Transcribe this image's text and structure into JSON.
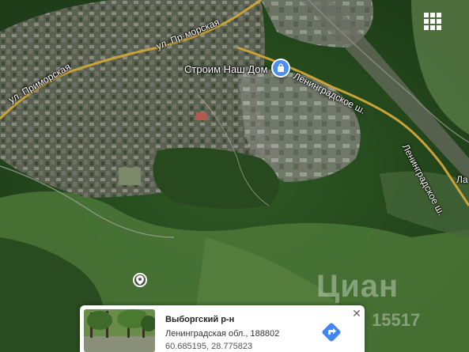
{
  "map": {
    "type": "satellite",
    "road_labels": {
      "primorskaya_left": "ул. Приморская",
      "primorskaya_top": "ул. Пр·морская",
      "leningradskoe_1": "Ленинградское ш.",
      "leningradskoe_2": "Ленинградское ш.",
      "edge": "Ла"
    },
    "place": {
      "name": "Строим Наш Дом",
      "icon": "shopping-bag-icon"
    },
    "controls": {
      "grid_icon": "apps-grid-icon",
      "location_marker_icon": "location-pin-icon"
    },
    "watermark": {
      "text": "Циан",
      "number": "15517"
    }
  },
  "info_card": {
    "title": "Выборгский р-н",
    "address": "Ленинградская обл., 188802",
    "coordinates": "60.685195, 28.775823",
    "directions_icon": "directions-arrow-icon",
    "directions_color": "#4285f4",
    "close_icon": "close-icon",
    "close_label": "✕"
  }
}
